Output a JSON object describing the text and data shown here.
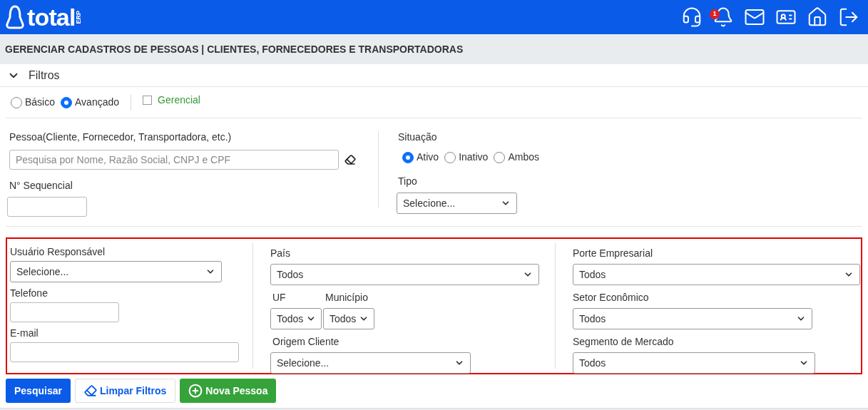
{
  "header": {
    "logo": {
      "text": "total",
      "tag": "ERP"
    },
    "notification_count": "1"
  },
  "page_title": "GERENCIAR CADASTROS DE PESSOAS | CLIENTES, FORNECEDORES E TRANSPORTADORAS",
  "filters": {
    "label": "Filtros",
    "expanded": true,
    "modes": [
      {
        "label": "Básico",
        "selected": false
      },
      {
        "label": "Avançado",
        "selected": true
      }
    ],
    "gerencial": {
      "label": "Gerencial",
      "checked": false
    },
    "pessoa": {
      "label": "Pessoa(Cliente, Fornecedor, Transportadora, etc.)",
      "placeholder": "Pesquisa por Nome, Razão Social, CNPJ e CPF"
    },
    "sequencial": {
      "label": "N° Sequencial"
    },
    "situacao": {
      "label": "Situação",
      "options": [
        {
          "label": "Ativo",
          "selected": true
        },
        {
          "label": "Inativo",
          "selected": false
        },
        {
          "label": "Ambos",
          "selected": false
        }
      ]
    },
    "tipo": {
      "label": "Tipo",
      "value": "Selecione..."
    },
    "advanced": {
      "usuario": {
        "label": "Usuário Responsável",
        "value": "Selecione..."
      },
      "telefone": {
        "label": "Telefone"
      },
      "email": {
        "label": "E-mail"
      },
      "pais": {
        "label": "País",
        "value": "Todos"
      },
      "uf": {
        "label": "UF",
        "value": "Todos"
      },
      "municipio": {
        "label": "Município",
        "value": "Todos"
      },
      "origem": {
        "label": "Origem Cliente",
        "value": "Selecione..."
      },
      "porte": {
        "label": "Porte Empresarial",
        "value": "Todos"
      },
      "setor": {
        "label": "Setor Econômico",
        "value": "Todos"
      },
      "segmento": {
        "label": "Segmento de Mercado",
        "value": "Todos"
      }
    }
  },
  "buttons": [
    {
      "kind": "primary",
      "label": "Pesquisar"
    },
    {
      "kind": "clear",
      "label": "Limpar Filtros"
    },
    {
      "kind": "add",
      "label": "Nova Pessoa"
    }
  ]
}
